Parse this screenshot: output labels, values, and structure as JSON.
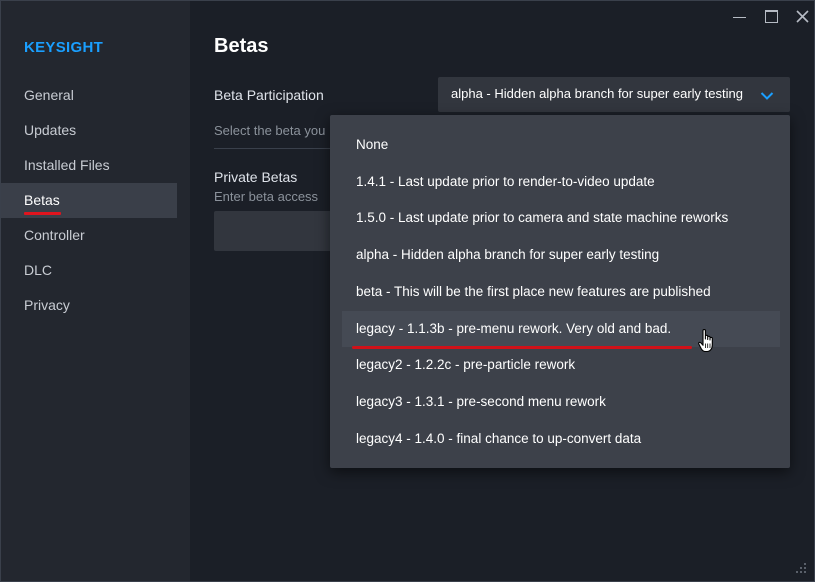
{
  "app": {
    "title": "KEYSIGHT",
    "accent": "#1a9fff",
    "underline_color": "#e0141e"
  },
  "window_controls": {
    "minimize": "minimize-icon",
    "maximize": "maximize-icon",
    "close": "close-icon"
  },
  "sidebar": {
    "items": [
      {
        "label": "General"
      },
      {
        "label": "Updates"
      },
      {
        "label": "Installed Files"
      },
      {
        "label": "Betas",
        "active": true
      },
      {
        "label": "Controller"
      },
      {
        "label": "DLC"
      },
      {
        "label": "Privacy"
      }
    ]
  },
  "main": {
    "title": "Betas",
    "beta_participation": {
      "label": "Beta Participation",
      "description": "Select the beta you",
      "selected": "alpha - Hidden alpha branch for super early testing"
    },
    "private_betas": {
      "label": "Private Betas",
      "description": "Enter beta access"
    }
  },
  "dropdown": {
    "options": [
      "None",
      "1.4.1 - Last update prior to render-to-video update",
      "1.5.0 - Last update prior to camera and state machine reworks",
      "alpha - Hidden alpha branch for super early testing",
      "beta - This will be the first place new features are published",
      "legacy - 1.1.3b - pre-menu rework. Very old and bad.",
      "legacy2 - 1.2.2c - pre-particle rework",
      "legacy3 - 1.3.1 - pre-second menu rework",
      "legacy4 - 1.4.0 - final chance to up-convert data"
    ],
    "hovered_index": 5
  }
}
